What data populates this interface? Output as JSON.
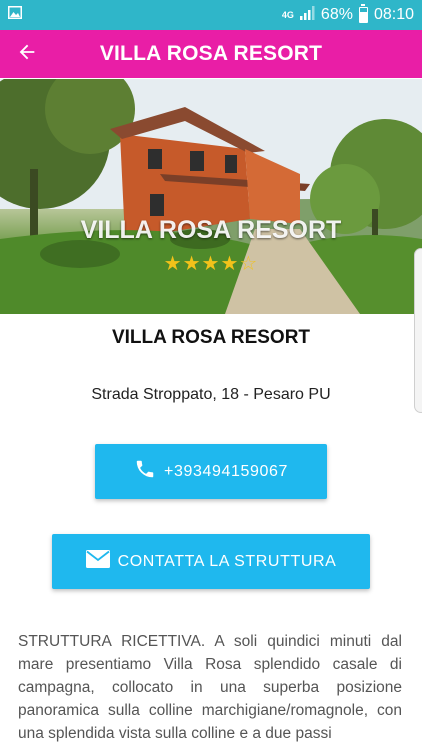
{
  "status_bar": {
    "network": "4G",
    "battery": "68%",
    "time": "08:10",
    "icons": [
      "image-icon",
      "signal-icon",
      "battery-icon"
    ]
  },
  "app_bar": {
    "title": "VILLA ROSA RESORT",
    "back_icon": "arrow-left-icon",
    "color": "#e91ea6"
  },
  "hero": {
    "title": "VILLA ROSA RESORT",
    "stars_filled": "★★★★",
    "stars_empty": "☆",
    "rating": 4,
    "rating_max": 5
  },
  "details": {
    "name": "VILLA ROSA RESORT",
    "address": "Strada Stroppato, 18 - Pesaro PU"
  },
  "actions": {
    "phone": "+393494159067",
    "phone_icon": "phone-icon",
    "contact": "CONTATTA LA STRUTTURA",
    "contact_icon": "envelope-icon",
    "color": "#1fb8ee"
  },
  "description": "STRUTTURA RICETTIVA. A soli quindici minuti dal mare presentiamo Villa Rosa splendido casale di campagna, collocato in una superba posizione panoramica sulla colline marchigiane/romagnole, con una splendida vista sulla colline e a due passi"
}
